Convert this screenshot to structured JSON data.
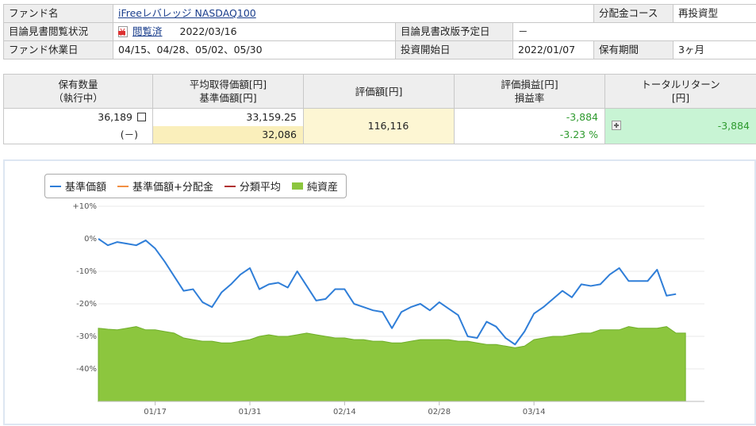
{
  "info": {
    "fund_name_label": "ファンド名",
    "fund_name": "iFreeレバレッジ NASDAQ100",
    "dist_course_label": "分配金コース",
    "dist_course": "再投資型",
    "prospectus_status_label": "目論見書閲覧状況",
    "prospectus_status": "閲覧済",
    "prospectus_date": "2022/03/16",
    "prospectus_revision_label": "目論見書改版予定日",
    "prospectus_revision": "－",
    "holidays_label": "ファンド休業日",
    "holidays": "04/15、04/28、05/02、05/30",
    "start_label": "投資開始日",
    "start_date": "2022/01/07",
    "period_label": "保有期間",
    "period": "3ヶ月"
  },
  "holding": {
    "h_qty_1": "保有数量",
    "h_qty_2": "（執行中）",
    "h_avg_1": "平均取得価額[円]",
    "h_avg_2": "基準価額[円]",
    "h_value": "評価額[円]",
    "h_pl_1": "評価損益[円]",
    "h_pl_2": "損益率",
    "h_total_1": "トータルリターン",
    "h_total_2": "[円]",
    "qty": "36,189",
    "pending": "(－)",
    "avg_cost": "33,159.25",
    "nav": "32,086",
    "value": "116,116",
    "pl": "-3,884",
    "pl_rate": "-3.23 %",
    "total_return": "-3,884"
  },
  "legend": [
    {
      "label": "基準価額",
      "color": "#2f7ed8"
    },
    {
      "label": "基準価額+分配金",
      "color": "#f28f43"
    },
    {
      "label": "分類平均",
      "color": "#b03030"
    },
    {
      "label": "純資産",
      "color": "#8cc63e"
    }
  ],
  "chart_data": {
    "type": "line",
    "x": [
      "01/07",
      "01/10",
      "01/11",
      "01/12",
      "01/13",
      "01/14",
      "01/17",
      "01/18",
      "01/19",
      "01/20",
      "01/21",
      "01/24",
      "01/25",
      "01/26",
      "01/27",
      "01/28",
      "01/31",
      "02/01",
      "02/02",
      "02/03",
      "02/04",
      "02/07",
      "02/08",
      "02/09",
      "02/10",
      "02/11",
      "02/14",
      "02/15",
      "02/16",
      "02/17",
      "02/18",
      "02/21",
      "02/22",
      "02/23",
      "02/24",
      "02/25",
      "02/28",
      "03/01",
      "03/02",
      "03/03",
      "03/04",
      "03/07",
      "03/08",
      "03/09",
      "03/10",
      "03/11",
      "03/14",
      "03/15",
      "03/16",
      "03/17",
      "03/18",
      "03/21",
      "03/22",
      "03/23",
      "03/24",
      "03/25",
      "03/28",
      "03/29",
      "03/30",
      "03/31",
      "04/01",
      "04/04",
      "04/05",
      "04/06",
      "04/07"
    ],
    "xticks": [
      "01/17",
      "01/31",
      "02/14",
      "02/28",
      "03/14"
    ],
    "ylim": [
      -50,
      10
    ],
    "yticks": [
      10,
      0,
      -10,
      -20,
      -30,
      -40
    ],
    "ytick_labels": [
      "+10%",
      "0%",
      "-10%",
      "-20%",
      "-30%",
      "-40%"
    ],
    "series": [
      {
        "name": "基準価額",
        "kind": "line",
        "color": "#2f7ed8",
        "values": [
          0,
          -2,
          -1,
          -1.5,
          -2,
          -0.5,
          -3,
          -7,
          -11.5,
          -16,
          -15.5,
          -19.5,
          -21,
          -16.5,
          -14,
          -11,
          -9,
          -15.5,
          -14,
          -13.5,
          -15,
          -10,
          -14.5,
          -19,
          -18.5,
          -15.5,
          -15.5,
          -20,
          -21,
          -22,
          -22.5,
          -27.5,
          -22.5,
          -21,
          -20,
          -22,
          -19.5,
          -21.5,
          -23.5,
          -30,
          -30.5,
          -25.5,
          -27,
          -30.5,
          -32.5,
          -28.5,
          -23,
          -21,
          -18.5,
          -16,
          -18,
          -14,
          -14.5,
          -14,
          -11,
          -9,
          -13,
          -13,
          -13,
          -9.5,
          -17.5,
          -17
        ]
      },
      {
        "name": "純資産",
        "kind": "area",
        "color": "#8cc63e",
        "values": [
          -27.5,
          -27.8,
          -28,
          -27.5,
          -27,
          -28,
          -28,
          -28.5,
          -29,
          -30.5,
          -31,
          -31.5,
          -31.5,
          -32,
          -32,
          -31.5,
          -31,
          -30,
          -29.5,
          -30,
          -30,
          -29.5,
          -29,
          -29.5,
          -30,
          -30.5,
          -30.5,
          -31,
          -31,
          -31.5,
          -31.5,
          -32,
          -32,
          -31.5,
          -31,
          -31,
          -31,
          -31,
          -31.5,
          -31.5,
          -32,
          -32.5,
          -32.5,
          -33,
          -33.5,
          -33,
          -31,
          -30.5,
          -30,
          -30,
          -29.5,
          -29,
          -29,
          -28,
          -28,
          -28,
          -27,
          -27.5,
          -27.5,
          -27.5,
          -27,
          -29,
          -29
        ]
      }
    ]
  }
}
